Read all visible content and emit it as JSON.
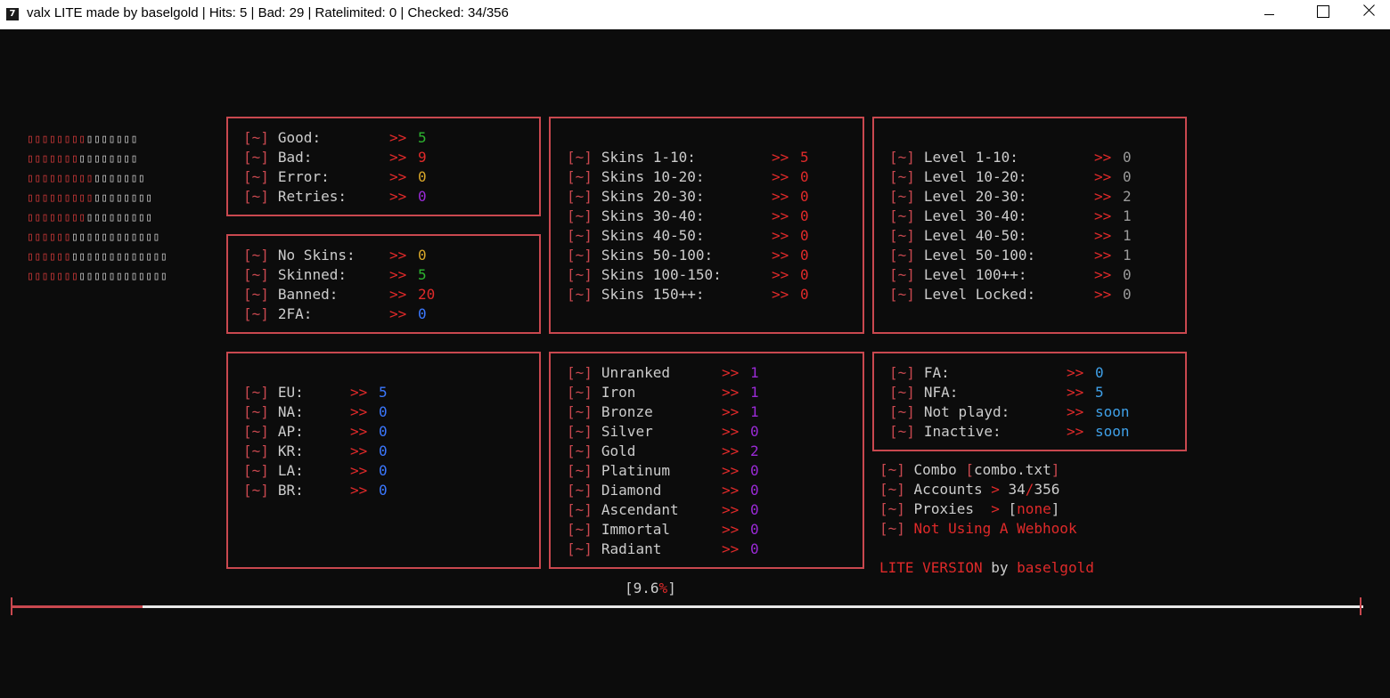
{
  "window": {
    "title": "valx LITE made by baselgold | Hits: 5 | Bad: 29 | Ratelimited: 0 | Checked: 34/356",
    "icon": "terminal-app-icon"
  },
  "prefix": "[~]",
  "arrow": ">>",
  "panel_good": {
    "rows": [
      {
        "label": "Good:",
        "value": "5"
      },
      {
        "label": "Bad:",
        "value": "9"
      },
      {
        "label": "Error:",
        "value": "0"
      },
      {
        "label": "Retries:",
        "value": "0"
      }
    ]
  },
  "panel_skinned": {
    "rows": [
      {
        "label": "No Skins:",
        "value": "0"
      },
      {
        "label": "Skinned:",
        "value": "5"
      },
      {
        "label": "Banned:",
        "value": "20"
      },
      {
        "label": "2FA:",
        "value": "0"
      }
    ]
  },
  "panel_skins": {
    "rows": [
      {
        "label": "Skins 1-10:",
        "value": "5"
      },
      {
        "label": "Skins 10-20:",
        "value": "0"
      },
      {
        "label": "Skins 20-30:",
        "value": "0"
      },
      {
        "label": "Skins 30-40:",
        "value": "0"
      },
      {
        "label": "Skins 40-50:",
        "value": "0"
      },
      {
        "label": "Skins 50-100:",
        "value": "0"
      },
      {
        "label": "Skins 100-150:",
        "value": "0"
      },
      {
        "label": "Skins 150++:",
        "value": "0"
      }
    ]
  },
  "panel_levels": {
    "rows": [
      {
        "label": "Level 1-10:",
        "value": "0"
      },
      {
        "label": "Level 10-20:",
        "value": "0"
      },
      {
        "label": "Level 20-30:",
        "value": "2"
      },
      {
        "label": "Level 30-40:",
        "value": "1"
      },
      {
        "label": "Level 40-50:",
        "value": "1"
      },
      {
        "label": "Level 50-100:",
        "value": "1"
      },
      {
        "label": "Level 100++:",
        "value": "0"
      },
      {
        "label": "Level Locked:",
        "value": "0"
      }
    ]
  },
  "panel_regions": {
    "rows": [
      {
        "label": "EU:",
        "value": "5"
      },
      {
        "label": "NA:",
        "value": "0"
      },
      {
        "label": "AP:",
        "value": "0"
      },
      {
        "label": "KR:",
        "value": "0"
      },
      {
        "label": "LA:",
        "value": "0"
      },
      {
        "label": "BR:",
        "value": "0"
      }
    ]
  },
  "panel_ranks": {
    "rows": [
      {
        "label": "Unranked",
        "value": "1"
      },
      {
        "label": "Iron",
        "value": "1"
      },
      {
        "label": "Bronze",
        "value": "1"
      },
      {
        "label": "Silver",
        "value": "0"
      },
      {
        "label": "Gold",
        "value": "2"
      },
      {
        "label": "Platinum",
        "value": "0"
      },
      {
        "label": "Diamond",
        "value": "0"
      },
      {
        "label": "Ascendant",
        "value": "0"
      },
      {
        "label": "Immortal",
        "value": "0"
      },
      {
        "label": "Radiant",
        "value": "0"
      }
    ]
  },
  "panel_fa": {
    "rows": [
      {
        "label": "FA:",
        "value": "0"
      },
      {
        "label": "NFA:",
        "value": "5"
      },
      {
        "label": "Not playd:",
        "value": "soon"
      },
      {
        "label": "Inactive:",
        "value": "soon"
      }
    ]
  },
  "info": {
    "combo_label": "Combo",
    "combo_file": "combo.txt",
    "accounts_label": "Accounts",
    "accounts_checked": "34",
    "accounts_total": "356",
    "proxies_label": "Proxies",
    "proxies_value": "none",
    "webhook_text": "Not Using A Webhook",
    "single_arrow": ">",
    "slash": "/",
    "bracket_open": "[",
    "bracket_close": "]"
  },
  "footer": {
    "lite_version": "LITE VERSION",
    "by": "by",
    "author": "baselgold"
  },
  "progress": {
    "value": "9.6",
    "percent_sign": "%",
    "bracket_open": "[",
    "bracket_close": "]",
    "fraction": 0.096
  },
  "colors": {
    "accent": "#c9484f",
    "arrow": "#e02a2a",
    "background": "#0c0c0c",
    "text": "#cccccc"
  }
}
